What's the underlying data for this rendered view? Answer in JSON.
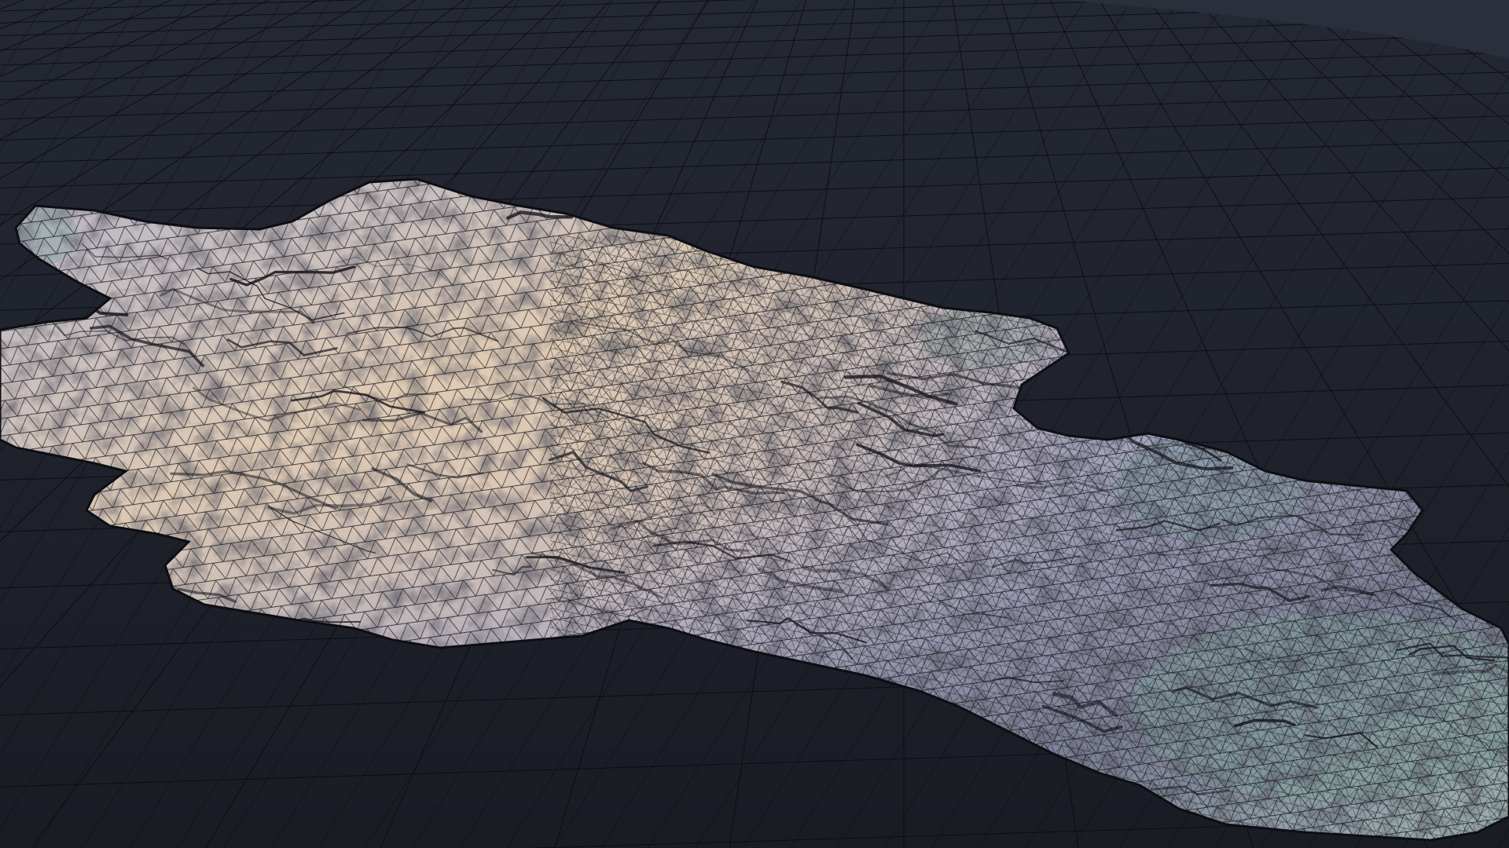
{
  "scene": {
    "description_free": true,
    "colors": {
      "background": "#1c1f28",
      "horizon": "#2a2e3a",
      "ground_plane": "#1d2029",
      "grid_line": "#0a0b0f",
      "terrain_light": "#c9c9dc",
      "terrain_warm": "#e8cba8",
      "terrain_mid": "#8c8ca6",
      "terrain_shadow": "#3b3c4c",
      "terrain_edge_teal": "#7fa39a",
      "wire": "#111217"
    }
  }
}
